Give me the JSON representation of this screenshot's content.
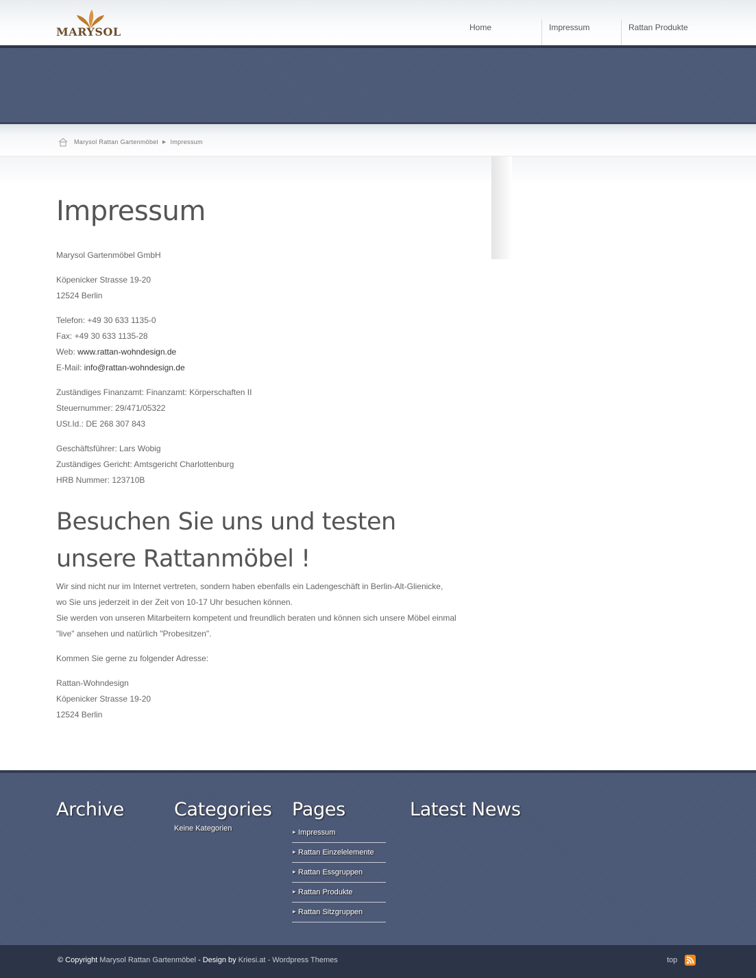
{
  "header": {
    "logo_text": "MARYSOL",
    "nav": [
      "Home",
      "Impressum",
      "Rattan Produkte"
    ]
  },
  "breadcrumb": {
    "items": [
      "Marysol Rattan Gartenmöbel",
      "Impressum"
    ]
  },
  "main": {
    "title": "Impressum",
    "company": "Marysol Gartenmöbel GmbH",
    "street": "Köpenicker Strasse 19-20",
    "city": "12524 Berlin",
    "telefon": "Telefon: +49 30 633 1135-0",
    "fax": "Fax: +49 30 633 1135-28",
    "web_label": "Web: ",
    "web_link": "www.rattan-wohndesign.de",
    "email_label": "E-Mail: ",
    "email_link": "info@rattan-wohndesign.de",
    "finanzamt": "Zuständiges Finanzamt: Finanzamt: Körperschaften II",
    "steuernummer": "Steuernummer: 29/471/05322",
    "ustid": "USt.Id.: DE 268 307 843",
    "geschaeftsfuehrer": "Geschäftsführer: Lars Wobig",
    "gericht": "Zuständiges Gericht: Amtsgericht Charlottenburg",
    "hrb": "HRB Nummer: 123710B",
    "visit_heading": "Besuchen Sie uns und testen unsere Rattanmöbel !",
    "visit_line1": "Wir sind nicht nur im Internet vertreten, sondern haben ebenfalls ein Ladengeschäft in Berlin-Alt-Glienicke,",
    "visit_line2": "wo Sie uns jederzeit in der Zeit von 10-17 Uhr besuchen können.",
    "visit_line3": "Sie werden von unseren Mitarbeitern kompetent und freundlich beraten und können sich unsere Möbel einmal \"live\" ansehen und natürlich \"Probesitzen\".",
    "address_intro": "Kommen Sie gerne zu folgender Adresse:",
    "addr_name": "Rattan-Wohndesign",
    "addr_street": "Köpenicker Strasse 19-20",
    "addr_city": "12524 Berlin"
  },
  "footer": {
    "archive_title": "Archive",
    "categories_title": "Categories",
    "categories_empty": "Keine Kategorien",
    "pages_title": "Pages",
    "pages": [
      "Impressum",
      "Rattan Einzelelemente",
      "Rattan Essgruppen",
      "Rattan Produkte",
      "Rattan Sitzgruppen"
    ],
    "news_title": "Latest News"
  },
  "bottombar": {
    "copyright": "© Copyright ",
    "site_link": "Marysol Rattan Gartenmöbel",
    "design_by": " - Design by ",
    "designer_link": "Kriesi.at",
    "sep": " - ",
    "themes_link": "Wordpress Themes",
    "top": "top"
  },
  "colors": {
    "banner": "#4d5a78",
    "footer": "#4b5877",
    "bottombar": "#2c3447",
    "rss": "#f28a1a"
  }
}
